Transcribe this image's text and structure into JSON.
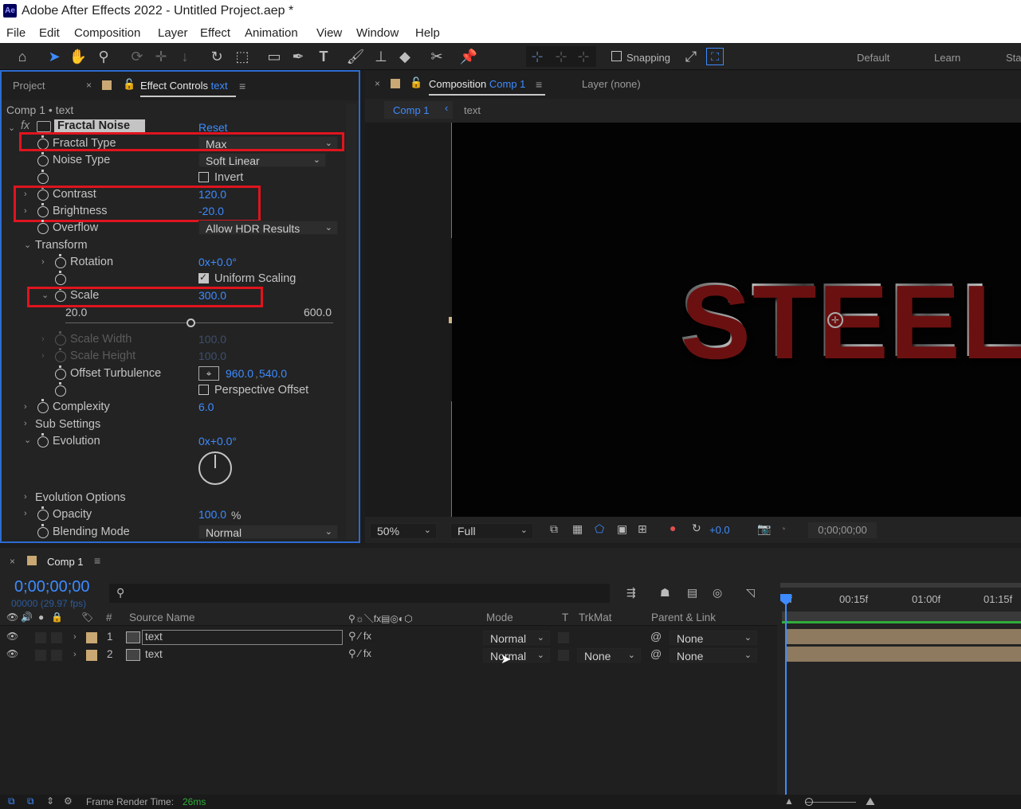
{
  "window": {
    "title": "Adobe After Effects 2022 - Untitled Project.aep *",
    "logo": "Ae"
  },
  "menu": [
    "File",
    "Edit",
    "Composition",
    "Layer",
    "Effect",
    "Animation",
    "View",
    "Window",
    "Help"
  ],
  "toolbar": {
    "snapping_label": "Snapping",
    "workspaces": [
      "Default",
      "Learn",
      "Sta"
    ]
  },
  "effect_panel": {
    "tab_project": "Project",
    "tab_effect_controls": "Effect Controls",
    "tab_effect_target": "text",
    "breadcrumb": "Comp 1 • text",
    "effect_name": "Fractal Noise",
    "reset_label": "Reset",
    "fractal_type": {
      "label": "Fractal Type",
      "value": "Max"
    },
    "noise_type": {
      "label": "Noise Type",
      "value": "Soft Linear"
    },
    "invert": {
      "label": "Invert",
      "checked": false
    },
    "contrast": {
      "label": "Contrast",
      "value": "120.0"
    },
    "brightness": {
      "label": "Brightness",
      "value": "-20.0"
    },
    "overflow": {
      "label": "Overflow",
      "value": "Allow HDR Results"
    },
    "transform": {
      "label": "Transform"
    },
    "rotation": {
      "label": "Rotation",
      "value": "0x+0.0°"
    },
    "uniform_scaling": {
      "label": "Uniform Scaling",
      "checked": true
    },
    "scale": {
      "label": "Scale",
      "value": "300.0",
      "slider_min": "20.0",
      "slider_max": "600.0",
      "slider_fraction": 0.47
    },
    "scale_width": {
      "label": "Scale Width",
      "value": "100.0"
    },
    "scale_height": {
      "label": "Scale Height",
      "value": "100.0"
    },
    "offset_turbulence": {
      "label": "Offset Turbulence",
      "x": "960.0",
      "y": "540.0"
    },
    "perspective_offset": {
      "label": "Perspective Offset",
      "checked": false
    },
    "complexity": {
      "label": "Complexity",
      "value": "6.0"
    },
    "sub_settings": {
      "label": "Sub Settings"
    },
    "evolution": {
      "label": "Evolution",
      "value": "0x+0.0°"
    },
    "evolution_options": {
      "label": "Evolution Options"
    },
    "opacity": {
      "label": "Opacity",
      "value": "100.0",
      "unit": "%"
    },
    "blending_mode": {
      "label": "Blending Mode",
      "value": "Normal"
    }
  },
  "comp_panel": {
    "tab_label": "Composition",
    "tab_target": "Comp 1",
    "layer_tab": "Layer (none)",
    "breadcrumb_comp": "Comp 1",
    "breadcrumb_layer": "text",
    "preview_text": "STEEL",
    "zoom": "50%",
    "resolution": "Full",
    "exposure": "+0.0",
    "timecode": "0;00;00;00"
  },
  "timeline": {
    "tab_label": "Comp 1",
    "timecode": "0;00;00;00",
    "fps": "00000 (29.97 fps)",
    "search_placeholder": "",
    "col_number": "#",
    "col_source": "Source Name",
    "col_mode": "Mode",
    "col_t": "T",
    "col_trkmat": "TrkMat",
    "col_parent": "Parent & Link",
    "ruler": [
      "0f",
      "00:15f",
      "01:00f",
      "01:15f"
    ],
    "layers": [
      {
        "num": "1",
        "name": "text",
        "mode": "Normal",
        "trkmat": "",
        "parent": "None"
      },
      {
        "num": "2",
        "name": "text",
        "mode": "Normal",
        "trkmat": "None",
        "parent": "None"
      }
    ]
  },
  "status": {
    "label": "Frame Render Time:",
    "value": "26ms"
  },
  "colors": {
    "accent": "#3d8bff",
    "highlight": "#e0141e",
    "panel_border": "#2d6bd1"
  }
}
